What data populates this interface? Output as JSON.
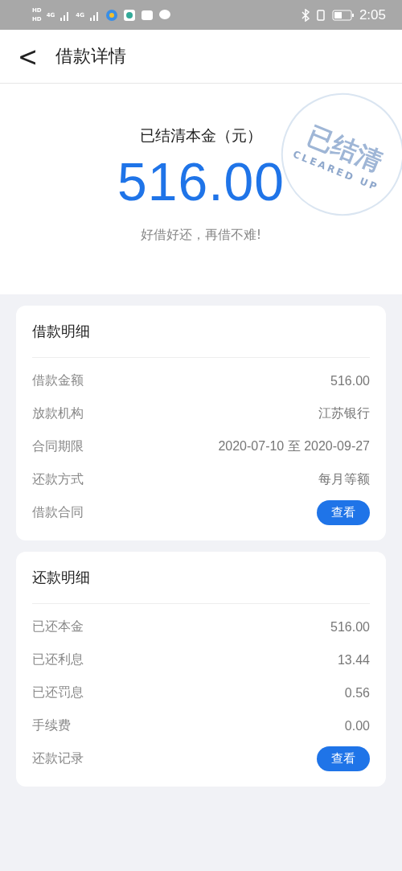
{
  "status_bar": {
    "sim_labels": [
      "HD",
      "HD"
    ],
    "network_labels": [
      "4G",
      "4G"
    ],
    "time": "2:05"
  },
  "header": {
    "back": "<",
    "title": "借款详情"
  },
  "summary": {
    "label": "已结清本金（元）",
    "amount": "516.00",
    "slogan": "好借好还，再借不难!",
    "stamp": {
      "text": "已结清",
      "subtext": "CLEARED UP"
    }
  },
  "cards": [
    {
      "title": "借款明细",
      "rows": [
        {
          "kind": "text",
          "label": "借款金额",
          "value": "516.00"
        },
        {
          "kind": "text",
          "label": "放款机构",
          "value": "江苏银行"
        },
        {
          "kind": "text",
          "label": "合同期限",
          "value": "2020-07-10 至 2020-09-27"
        },
        {
          "kind": "text",
          "label": "还款方式",
          "value": "每月等额"
        },
        {
          "kind": "button",
          "label": "借款合同",
          "value": "查看"
        }
      ]
    },
    {
      "title": "还款明细",
      "rows": [
        {
          "kind": "text",
          "label": "已还本金",
          "value": "516.00"
        },
        {
          "kind": "text",
          "label": "已还利息",
          "value": "13.44"
        },
        {
          "kind": "text",
          "label": "已还罚息",
          "value": "0.56"
        },
        {
          "kind": "text",
          "label": "手续费",
          "value": "0.00"
        },
        {
          "kind": "button",
          "label": "还款记录",
          "value": "查看"
        }
      ]
    }
  ]
}
